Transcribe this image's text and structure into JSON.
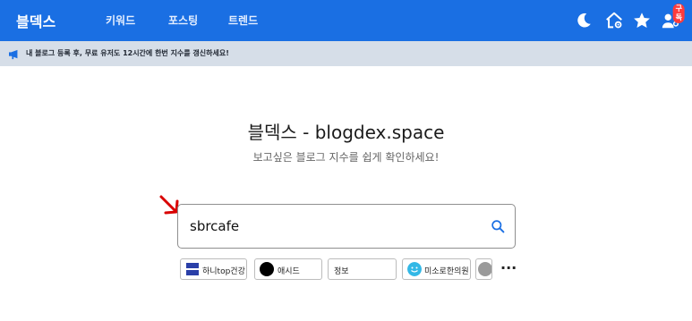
{
  "header": {
    "logo": "블덱스",
    "nav": [
      {
        "label": "키워드"
      },
      {
        "label": "포스팅"
      },
      {
        "label": "트렌드"
      }
    ],
    "icons": [
      "moon-icon",
      "home-settings-icon",
      "star-icon",
      "user-subscribe-icon"
    ],
    "subscribe_badge": "구독",
    "accent_color": "#1a6fe3"
  },
  "notice": {
    "icon": "megaphone-icon",
    "text": "내 블로그 등록 후, 무료 유저도 12시간에 한번 지수를 갱신하세요!"
  },
  "hero": {
    "title": "블덱스 - blogdex.space",
    "subtitle": "보고싶은 블로그 지수를 쉽게 확인하세요!"
  },
  "search": {
    "value": "sbrcafe",
    "icon": "search-icon"
  },
  "recent_chips": [
    {
      "label": "하니top건강",
      "avatar": "logo-avatar"
    },
    {
      "label": "애시드",
      "avatar": "black-circle-avatar"
    },
    {
      "label": "정보",
      "avatar": ""
    },
    {
      "label": "미소로한의원",
      "avatar": "smiley-avatar"
    },
    {
      "label": "",
      "avatar": "gray-avatar"
    }
  ],
  "more_label": "···"
}
